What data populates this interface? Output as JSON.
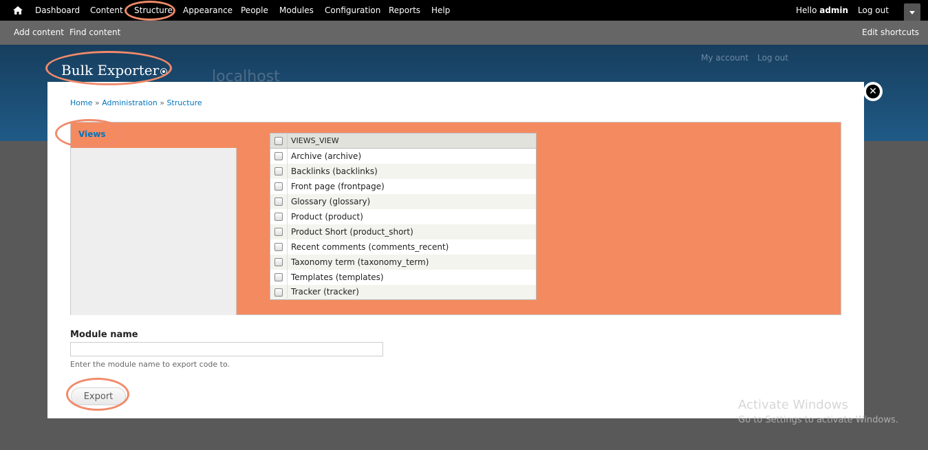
{
  "toolbar": {
    "items": [
      "Dashboard",
      "Content",
      "Structure",
      "Appearance",
      "People",
      "Modules",
      "Configuration",
      "Reports",
      "Help"
    ],
    "greeting": "Hello ",
    "username": "admin",
    "logout": "Log out"
  },
  "shortcuts": {
    "add_content": "Add content",
    "find_content": "Find content",
    "edit_shortcuts": "Edit shortcuts"
  },
  "site": {
    "name": "localhost",
    "my_account": "My account",
    "log_out": "Log out"
  },
  "overlay": {
    "title": "Bulk Exporter",
    "close_icon": "close-icon"
  },
  "breadcrumb": {
    "home": "Home",
    "sep1": " » ",
    "administration": "Administration",
    "sep2": " » ",
    "structure": "Structure"
  },
  "vertical_tabs": {
    "active": "Views"
  },
  "views_table": {
    "header": "VIEWS_VIEW",
    "rows": [
      "Archive (archive)",
      "Backlinks (backlinks)",
      "Front page (frontpage)",
      "Glossary (glossary)",
      "Product (product)",
      "Product Short (product_short)",
      "Recent comments (comments_recent)",
      "Taxonomy term (taxonomy_term)",
      "Templates (templates)",
      "Tracker (tracker)"
    ]
  },
  "module_form": {
    "label": "Module name",
    "value": "",
    "description": "Enter the module name to export code to.",
    "submit": "Export"
  },
  "watermark": {
    "line1": "Activate Windows",
    "line2": "Go to Settings to activate Windows."
  },
  "colors": {
    "annotation": "#f08a6a",
    "tabs_background": "#f48a60",
    "link": "#0074bd"
  }
}
